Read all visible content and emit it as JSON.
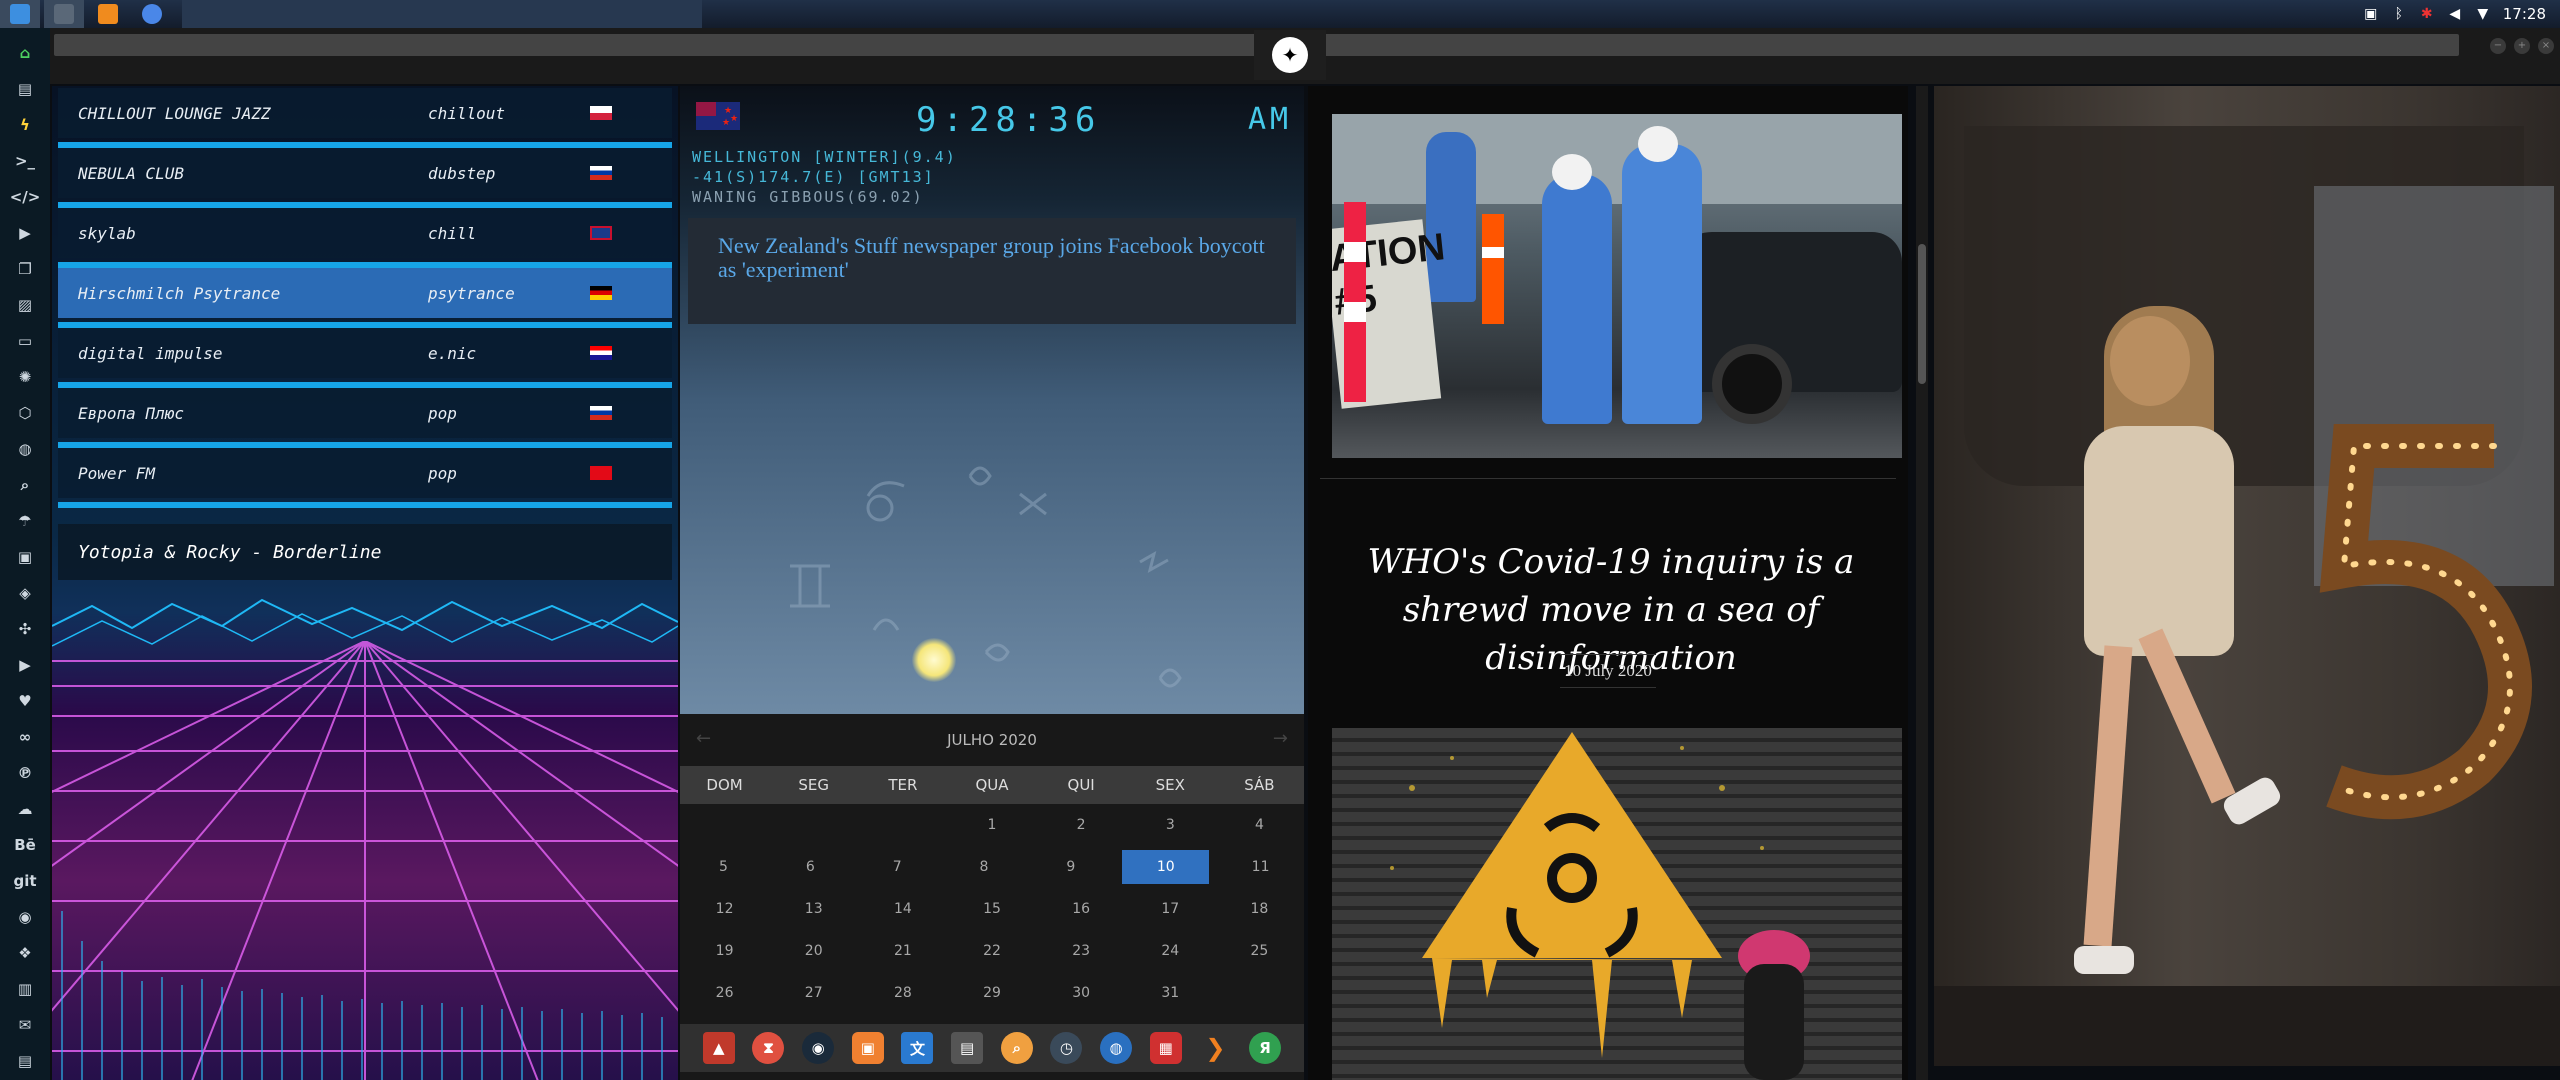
{
  "taskbar": {
    "apps": [
      "files-app",
      "terminal-app",
      "sublime-app",
      "chrome-app"
    ],
    "time": "17:28"
  },
  "dock": {
    "items": [
      "home-icon",
      "document-icon",
      "bolt-icon",
      "terminal-icon",
      "code-icon",
      "play-icon",
      "copy-icon",
      "image-icon",
      "card-icon",
      "atom-icon",
      "hexagon-icon",
      "globe-icon",
      "search-icon",
      "umbrella-icon",
      "contact-icon",
      "tag-icon",
      "expand-icon",
      "youtube-icon",
      "heart-icon",
      "link-icon",
      "pinterest-icon",
      "cloud-icon",
      "behance-icon",
      "git-icon",
      "github-icon",
      "dropbox-icon",
      "map-icon",
      "mail-icon",
      "inbox-icon"
    ],
    "labels": {
      "behance": "Bē",
      "git": "git"
    }
  },
  "radio": {
    "stations": [
      {
        "name": "CHILLOUT LOUNGE JAZZ",
        "genre": "chillout"
      },
      {
        "name": "NEBULA CLUB",
        "genre": "dubstep"
      },
      {
        "name": "skylab",
        "genre": "chill"
      },
      {
        "name": "Hirschmilch Psytrance",
        "genre": "psytrance"
      },
      {
        "name": "digital impulse",
        "genre": "e.nic"
      },
      {
        "name": "Европа Плюс",
        "genre": "pop"
      },
      {
        "name": "Power FM",
        "genre": "pop"
      }
    ],
    "selected_index": 3,
    "now_playing": "Yotopia & Rocky - Borderline"
  },
  "world_clock": {
    "time": "9:28:36",
    "ampm": "AM",
    "line1": "WELLINGTON [WINTER](9.4)",
    "line2": "-41(S)174.7(E) [GMT13]",
    "line3": "WANING GIBBOUS(69.02)",
    "news": "New Zealand's Stuff newspaper group joins Facebook boycott as 'experiment'"
  },
  "calendar": {
    "month": "JULHO 2020",
    "weekdays": [
      "DOM",
      "SEG",
      "TER",
      "QUA",
      "QUI",
      "SEX",
      "SÁB"
    ],
    "weeks": [
      [
        "",
        "",
        "",
        "1",
        "2",
        "3",
        "4"
      ],
      [
        "5",
        "6",
        "7",
        "8",
        "9",
        "10",
        "11"
      ],
      [
        "12",
        "13",
        "14",
        "15",
        "16",
        "17",
        "18"
      ],
      [
        "19",
        "20",
        "21",
        "22",
        "23",
        "24",
        "25"
      ],
      [
        "26",
        "27",
        "28",
        "29",
        "30",
        "31",
        ""
      ]
    ],
    "today": "10",
    "prev": "←",
    "next": "→"
  },
  "launcher": [
    "arrow-app",
    "hourglass-app",
    "globe-dark-app",
    "photo-app",
    "translate-app",
    "news-app",
    "search-app",
    "clock-app",
    "web-app",
    "calendar-app",
    "play-app",
    "yandex-app"
  ],
  "news_feed": {
    "headline": "WHO's Covid-19 inquiry is a shrewd move in a sea of disinformation",
    "date": "10 July 2020",
    "photo1_sign": "ATION\n#5"
  },
  "colors": {
    "accent": "#3071c0",
    "cyan": "#46c8e8",
    "neon": "#16a5e8"
  }
}
